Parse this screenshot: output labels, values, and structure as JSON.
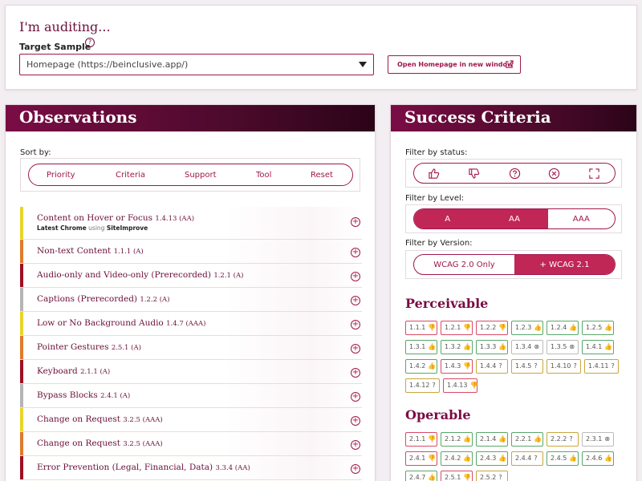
{
  "top": {
    "title": "I'm auditing...",
    "target_label": "Target Sample",
    "help_glyph": "?",
    "select_value": "Homepage (https://beinclusive.app/)",
    "open_button": "Open Homepage in new window"
  },
  "observations": {
    "heading": "Observations",
    "sort_label": "Sort by:",
    "sort_items": [
      "Priority",
      "Criteria",
      "Support",
      "Tool",
      "Reset"
    ],
    "items": [
      {
        "title": "Content on Hover or Focus",
        "code": "1.4.13 (AA)",
        "sub_browser": "Latest Chrome",
        "sub_using": "using",
        "sub_tool": "SiteImprove",
        "color": "#e8d52a"
      },
      {
        "title": "Non-text Content",
        "code": "1.1.1 (A)",
        "color": "#e07a2c"
      },
      {
        "title": "Audio-only and Video-only (Prerecorded)",
        "code": "1.2.1 (A)",
        "color": "#a01020"
      },
      {
        "title": "Captions (Prerecorded)",
        "code": "1.2.2 (A)",
        "color": "#b5b5b5"
      },
      {
        "title": "Low or No Background Audio",
        "code": "1.4.7 (AAA)",
        "color": "#e8d52a"
      },
      {
        "title": "Pointer Gestures",
        "code": "2.5.1 (A)",
        "color": "#e07a2c"
      },
      {
        "title": "Keyboard",
        "code": "2.1.1 (A)",
        "color": "#a01020"
      },
      {
        "title": "Bypass Blocks",
        "code": "2.4.1 (A)",
        "color": "#b5b5b5"
      },
      {
        "title": "Change on Request",
        "code": "3.2.5 (AAA)",
        "color": "#e8d52a"
      },
      {
        "title": "Change on Request",
        "code": "3.2.5 (AAA)",
        "color": "#e07a2c"
      },
      {
        "title": "Error Prevention (Legal, Financial, Data)",
        "code": "3.3.4 (AA)",
        "color": "#a01020"
      }
    ]
  },
  "success": {
    "heading": "Success Criteria",
    "filter_status_label": "Filter by status:",
    "filter_level_label": "Filter by Level:",
    "levels": [
      "A",
      "AA",
      "AAA"
    ],
    "filter_version_label": "Filter by Version:",
    "versions": [
      "WCAG 2.0 Only",
      "+ WCAG 2.1"
    ],
    "perceivable_heading": "Perceivable",
    "operable_heading": "Operable",
    "perceivable_chips": [
      {
        "label": "1.1.1",
        "status": "fail"
      },
      {
        "label": "1.2.1",
        "status": "fail"
      },
      {
        "label": "1.2.2",
        "status": "fail"
      },
      {
        "label": "1.2.3",
        "status": "pass"
      },
      {
        "label": "1.2.4",
        "status": "pass"
      },
      {
        "label": "1.2.5",
        "status": "pass"
      },
      {
        "label": "1.3.1",
        "status": "pass"
      },
      {
        "label": "1.3.2",
        "status": "pass"
      },
      {
        "label": "1.3.3",
        "status": "pass"
      },
      {
        "label": "1.3.4",
        "status": "na"
      },
      {
        "label": "1.3.5",
        "status": "na"
      },
      {
        "label": "1.4.1",
        "status": "pass"
      },
      {
        "label": "1.4.2",
        "status": "pass"
      },
      {
        "label": "1.4.3",
        "status": "fail"
      },
      {
        "label": "1.4.4",
        "status": "help"
      },
      {
        "label": "1.4.5",
        "status": "help"
      },
      {
        "label": "1.4.10",
        "status": "help"
      },
      {
        "label": "1.4.11",
        "status": "help"
      },
      {
        "label": "1.4.12",
        "status": "help"
      },
      {
        "label": "1.4.13",
        "status": "fail"
      }
    ],
    "operable_chips": [
      {
        "label": "2.1.1",
        "status": "fail"
      },
      {
        "label": "2.1.2",
        "status": "pass"
      },
      {
        "label": "2.1.4",
        "status": "pass"
      },
      {
        "label": "2.2.1",
        "status": "pass"
      },
      {
        "label": "2.2.2",
        "status": "help"
      },
      {
        "label": "2.3.1",
        "status": "na"
      },
      {
        "label": "2.4.1",
        "status": "fail"
      },
      {
        "label": "2.4.2",
        "status": "pass"
      },
      {
        "label": "2.4.3",
        "status": "pass"
      },
      {
        "label": "2.4.4",
        "status": "help"
      },
      {
        "label": "2.4.5",
        "status": "pass"
      },
      {
        "label": "2.4.6",
        "status": "pass"
      },
      {
        "label": "2.4.7",
        "status": "pass"
      },
      {
        "label": "2.5.1",
        "status": "fail"
      },
      {
        "label": "2.5.2",
        "status": "help"
      }
    ]
  },
  "colors": {
    "accent": "#a1174c",
    "header_dark": "#4d0a2c",
    "pass": "#59a86a",
    "fail": "#d94a66",
    "help": "#c9a640"
  }
}
